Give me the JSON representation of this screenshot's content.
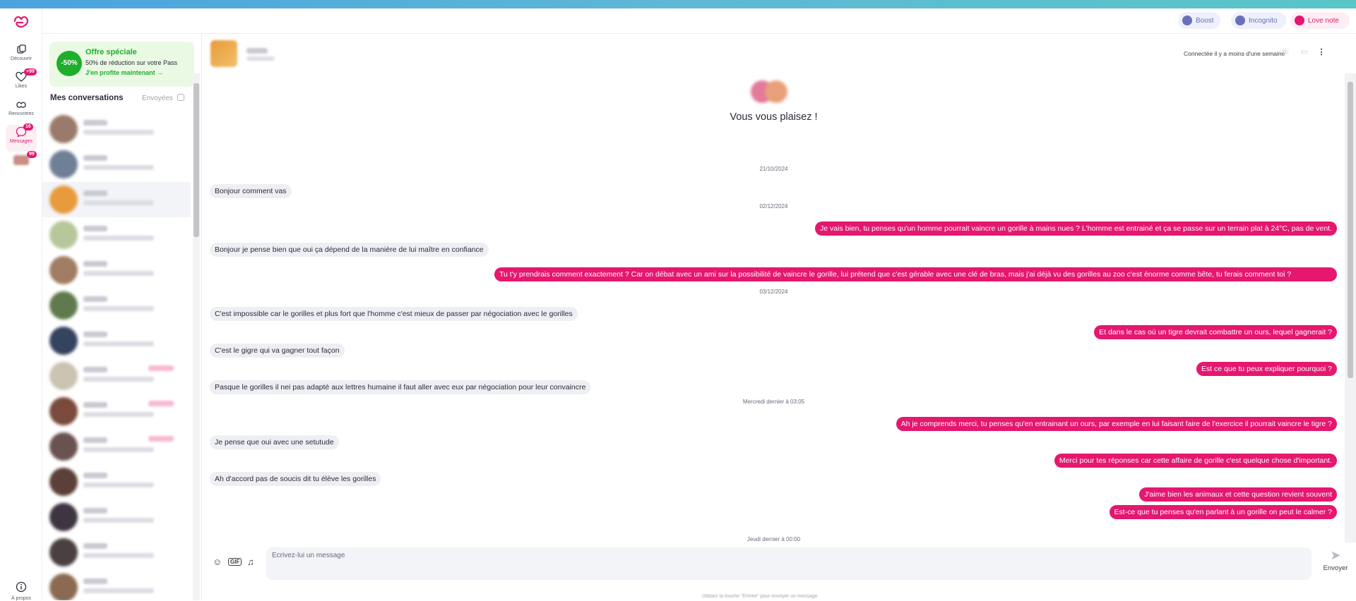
{
  "nav": {
    "items": [
      {
        "label": "Découvrir",
        "icon": "cards-icon",
        "badge": ""
      },
      {
        "label": "Likes",
        "icon": "heart-icon",
        "badge": "+99"
      },
      {
        "label": "Rencontres",
        "icon": "match-icon",
        "badge": ""
      },
      {
        "label": "Messages",
        "icon": "chat-heart-icon",
        "badge": "16"
      },
      {
        "label": "",
        "icon": "profile-avatar",
        "badge": "99"
      }
    ],
    "about_label": "À propos"
  },
  "header": {
    "boost": "Boost",
    "incognito": "Incognito",
    "love_note": "Love note"
  },
  "offer": {
    "percent": "-50%",
    "title": "Offre spéciale",
    "subtitle": "50% de réduction sur votre Pass",
    "cta": "J'en profite maintenant →"
  },
  "conversations": {
    "title": "Mes conversations",
    "sent_label": "Envoyées",
    "rows": [
      {
        "color": "#9a7a6a",
        "tag": false,
        "active": false
      },
      {
        "color": "#6f7f96",
        "tag": false,
        "active": false
      },
      {
        "color": "#e79b3c",
        "tag": false,
        "active": true
      },
      {
        "color": "#b7c79a",
        "tag": false,
        "active": false
      },
      {
        "color": "#a07c62",
        "tag": false,
        "active": false
      },
      {
        "color": "#5f7a4f",
        "tag": false,
        "active": false
      },
      {
        "color": "#34435f",
        "tag": false,
        "active": false
      },
      {
        "color": "#c9c3b0",
        "tag": true,
        "active": false
      },
      {
        "color": "#7a4a3c",
        "tag": true,
        "active": false
      },
      {
        "color": "#6a5250",
        "tag": true,
        "active": false
      },
      {
        "color": "#5a4038",
        "tag": false,
        "active": false
      },
      {
        "color": "#3d3540",
        "tag": false,
        "active": false
      },
      {
        "color": "#4a4040",
        "tag": false,
        "active": false
      },
      {
        "color": "#8a6a50",
        "tag": false,
        "active": false
      }
    ]
  },
  "chat": {
    "status": "Connectée il y a moins d'une semaine",
    "match_title": "Vous vous plaisez !",
    "composer_placeholder": "Ecrivez-lui un message",
    "send_label": "Envoyer",
    "hint": "Utilisez la touche \"Entrée\" pour envoyer un message",
    "items": [
      {
        "kind": "date",
        "text": "21/10/2024"
      },
      {
        "kind": "in",
        "text": "Bonjour comment vas"
      },
      {
        "kind": "date",
        "text": "02/12/2024"
      },
      {
        "kind": "out",
        "text": "Je vais bien, tu penses qu'un homme pourrait vaincre un gorille à mains nues ? L'homme est entrainé et ça se passe sur un terrain plat à 24°C, pas de vent."
      },
      {
        "kind": "in",
        "text": "Bonjour je pense bien que oui ça dépend de la manière de lui maître en confiance"
      },
      {
        "kind": "out",
        "text": "Tu t'y prendrais comment exactement ? Car on débat avec un ami sur la possibilité de vaincre le gorille, lui prétend que c'est gérable avec une clé de bras, mais j'ai déjà vu des gorilles au zoo c'est énorme comme bête, tu ferais comment toi ?"
      },
      {
        "kind": "date",
        "text": "03/12/2024"
      },
      {
        "kind": "in",
        "text": "C'est impossible car le gorilles et plus fort que l'homme c'est mieux de passer par négociation avec le gorilles"
      },
      {
        "kind": "out",
        "text": "Et dans le cas où un tigre devrait combattre un ours, lequel gagnerait ?"
      },
      {
        "kind": "in",
        "text": "C'est le gigre qui va gagner tout façon"
      },
      {
        "kind": "out",
        "text": "Est ce que tu peux expliquer pourquoi ?"
      },
      {
        "kind": "in",
        "text": "Pasque le gorilles il nei pas adapté aux lettres humaine il faut aller avec eux par négociation pour leur convaincre"
      },
      {
        "kind": "date",
        "text": "Mercredi dernier à 03:05"
      },
      {
        "kind": "out",
        "text": "Ah je comprends merci, tu penses qu'en entrainant un ours, par exemple en lui faisant faire de l'exercice il pourrait vaincre le tigre ?"
      },
      {
        "kind": "in",
        "text": "Je pense que oui avec une setutude"
      },
      {
        "kind": "out",
        "text": "Merci pour tes réponses car cette affaire de gorille c'est quelque chose d'important."
      },
      {
        "kind": "in",
        "text": "Ah d'accord pas de soucis dit tu élève les gorilles"
      },
      {
        "kind": "out",
        "text": "J'aime bien les animaux et cette question revient souvent"
      },
      {
        "kind": "out",
        "text": "Est-ce que tu penses qu'en parlant à un gorille on peut le calmer ?"
      },
      {
        "kind": "date",
        "text": "Jeudi dernier à 00:00"
      }
    ]
  },
  "colors": {
    "accent": "#e5176f",
    "offer_green": "#1fae2c",
    "bubble_in": "#eeeff3"
  }
}
